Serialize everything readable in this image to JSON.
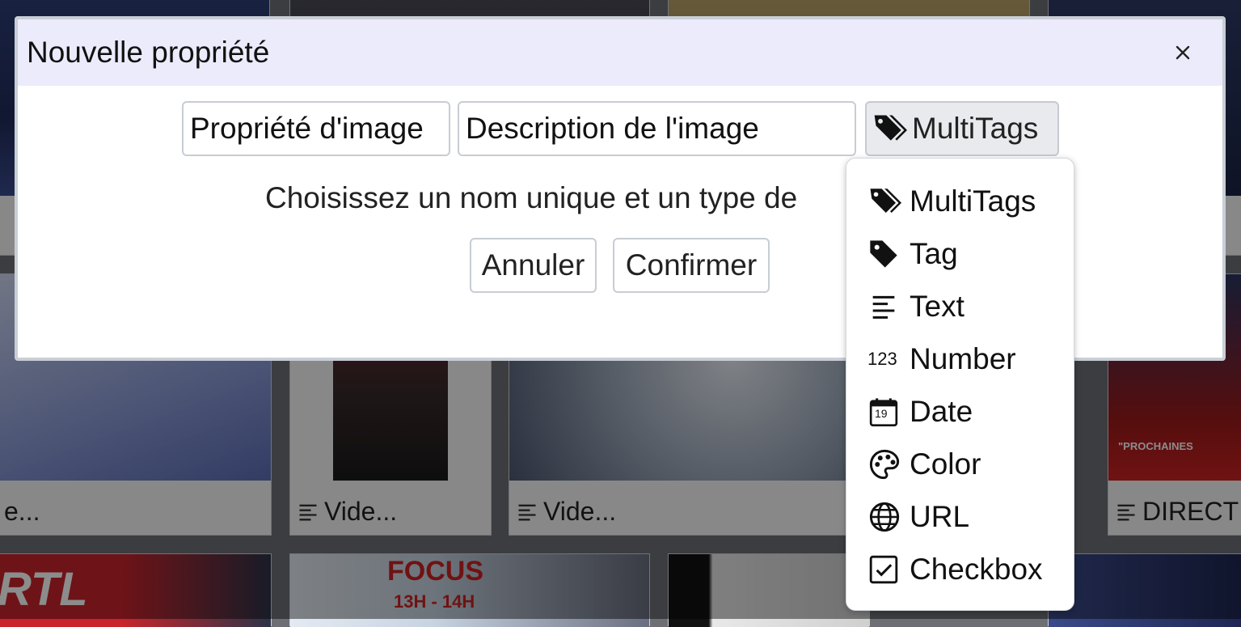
{
  "background": {
    "captions": [
      "e...",
      "Vide...",
      "Vide...",
      "DIRECT"
    ],
    "thumb_texts": {
      "focus_title": "FOCUS",
      "focus_time": "13H - 14H",
      "rtl": "RTL",
      "prochaines": "\"PROCHAINES"
    }
  },
  "modal": {
    "title": "Nouvelle propriété",
    "close_label": "×",
    "name_value": "Propriété d'image",
    "description_value": "Description de l'image",
    "type_selected": "MultiTags",
    "help_text": "Choisissez un nom unique et un type de",
    "cancel_label": "Annuler",
    "confirm_label": "Confirmer"
  },
  "menu": {
    "items": [
      {
        "label": "MultiTags",
        "icon": "tags-icon"
      },
      {
        "label": "Tag",
        "icon": "tag-icon"
      },
      {
        "label": "Text",
        "icon": "text-lines-icon"
      },
      {
        "label": "Number",
        "icon": "number-123-icon"
      },
      {
        "label": "Date",
        "icon": "calendar-icon"
      },
      {
        "label": "Color",
        "icon": "palette-icon"
      },
      {
        "label": "URL",
        "icon": "globe-icon"
      },
      {
        "label": "Checkbox",
        "icon": "checkbox-icon"
      }
    ],
    "number_icon_text": "123",
    "date_icon_text": "19"
  },
  "colors": {
    "header_bg": "#ecebfb",
    "overlay": "rgba(0,0,0,0.45)"
  }
}
